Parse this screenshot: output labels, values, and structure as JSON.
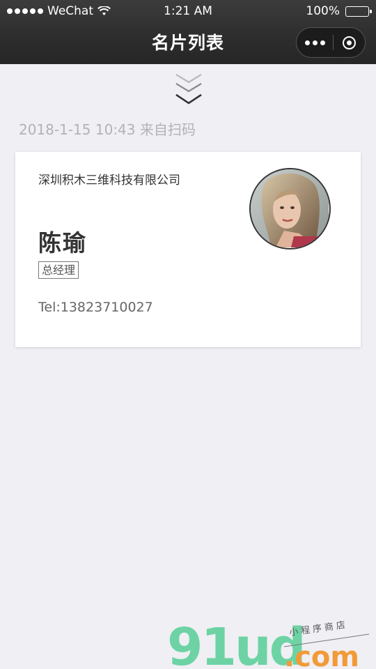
{
  "status_bar": {
    "carrier": "WeChat",
    "time": "1:21 AM",
    "battery": "100%"
  },
  "nav": {
    "title": "名片列表"
  },
  "feed": {
    "timestamp": "2018-1-15 10:43 来自扫码"
  },
  "card": {
    "company": "深圳积木三维科技有限公司",
    "name": "陈瑜",
    "title": "总经理",
    "tel": "Tel:13823710027"
  },
  "watermark": {
    "brand": "91ud",
    "domain": ".com",
    "tagline": "小程序商店"
  },
  "colors": {
    "background": "#efeff4",
    "navbar": "#2f2f2f",
    "card": "#ffffff",
    "watermark_green": "#6dd3a4",
    "watermark_orange": "#f29a38"
  },
  "icons": [
    "wifi-icon",
    "battery-icon",
    "more-dots-icon",
    "close-target-icon",
    "chevrons-down-icon"
  ]
}
